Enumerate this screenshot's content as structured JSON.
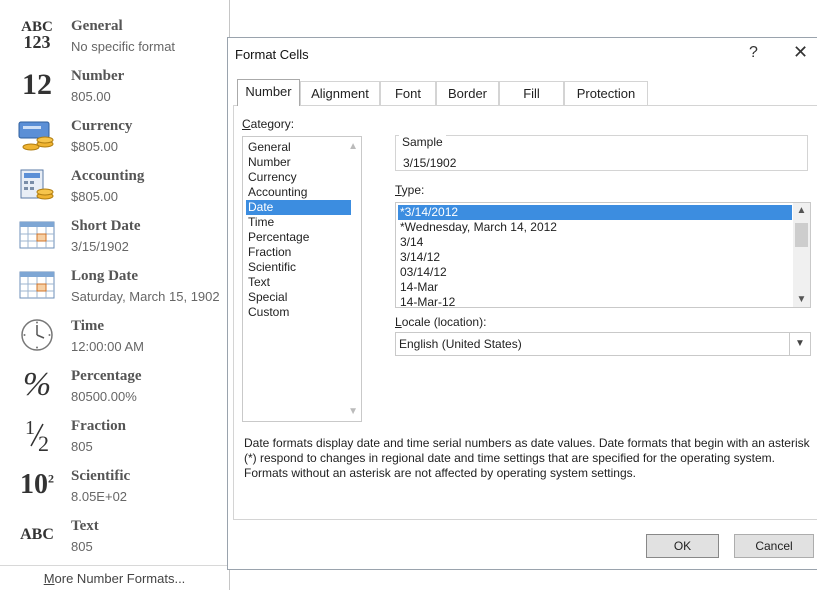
{
  "number_format_menu": {
    "items": [
      {
        "label": "General",
        "sample": "No specific format",
        "icon": "abc-123-icon",
        "glyph_top": "ABC",
        "glyph_bottom": "123"
      },
      {
        "label": "Number",
        "sample": "805.00",
        "icon": "number-12-icon",
        "glyph": "12"
      },
      {
        "label": "Currency",
        "sample": "$805.00",
        "icon": "currency-icon"
      },
      {
        "label": "Accounting",
        "sample": "$805.00",
        "icon": "accounting-icon"
      },
      {
        "label": "Short Date",
        "sample": "3/15/1902",
        "icon": "short-date-calendar-icon"
      },
      {
        "label": "Long Date",
        "sample": "Saturday, March 15, 1902",
        "icon": "long-date-calendar-icon"
      },
      {
        "label": "Time",
        "sample": "12:00:00 AM",
        "icon": "clock-icon"
      },
      {
        "label": "Percentage",
        "sample": "80500.00%",
        "icon": "percent-icon",
        "glyph": "%"
      },
      {
        "label": "Fraction",
        "sample": "805",
        "icon": "fraction-icon",
        "glyph_top": "1",
        "glyph_bottom": "2"
      },
      {
        "label": "Scientific",
        "sample": "8.05E+02",
        "icon": "scientific-icon",
        "glyph": "10",
        "glyph_sup": "2"
      },
      {
        "label": "Text",
        "sample": "805",
        "icon": "abc-text-icon",
        "glyph": "ABC"
      }
    ],
    "more_label_prefix": "M",
    "more_label_rest": "ore Number Formats..."
  },
  "dialog": {
    "title": "Format Cells",
    "help_label": "?",
    "close_label": "✕",
    "tabs": [
      "Number",
      "Alignment",
      "Font",
      "Border",
      "Fill",
      "Protection"
    ],
    "active_tab": "Number",
    "category_label_accel": "C",
    "category_label_rest": "ategory:",
    "categories": [
      "General",
      "Number",
      "Currency",
      "Accounting",
      "Date",
      "Time",
      "Percentage",
      "Fraction",
      "Scientific",
      "Text",
      "Special",
      "Custom"
    ],
    "selected_category": "Date",
    "sample_label": "Sample",
    "sample_value": "3/15/1902",
    "type_label_accel": "T",
    "type_label_rest": "ype:",
    "types": [
      "*3/14/2012",
      "*Wednesday, March 14, 2012",
      "3/14",
      "3/14/12",
      "03/14/12",
      "14-Mar",
      "14-Mar-12"
    ],
    "selected_type": "*3/14/2012",
    "locale_label_accel": "L",
    "locale_label_rest": "ocale (location):",
    "locale_value": "English (United States)",
    "description": "Date formats display date and time serial numbers as date values.  Date formats that begin with an asterisk (*) respond to changes in regional date and time settings that are specified for the operating system. Formats without an asterisk are not affected by operating system settings.",
    "ok_label": "OK",
    "cancel_label": "Cancel"
  }
}
